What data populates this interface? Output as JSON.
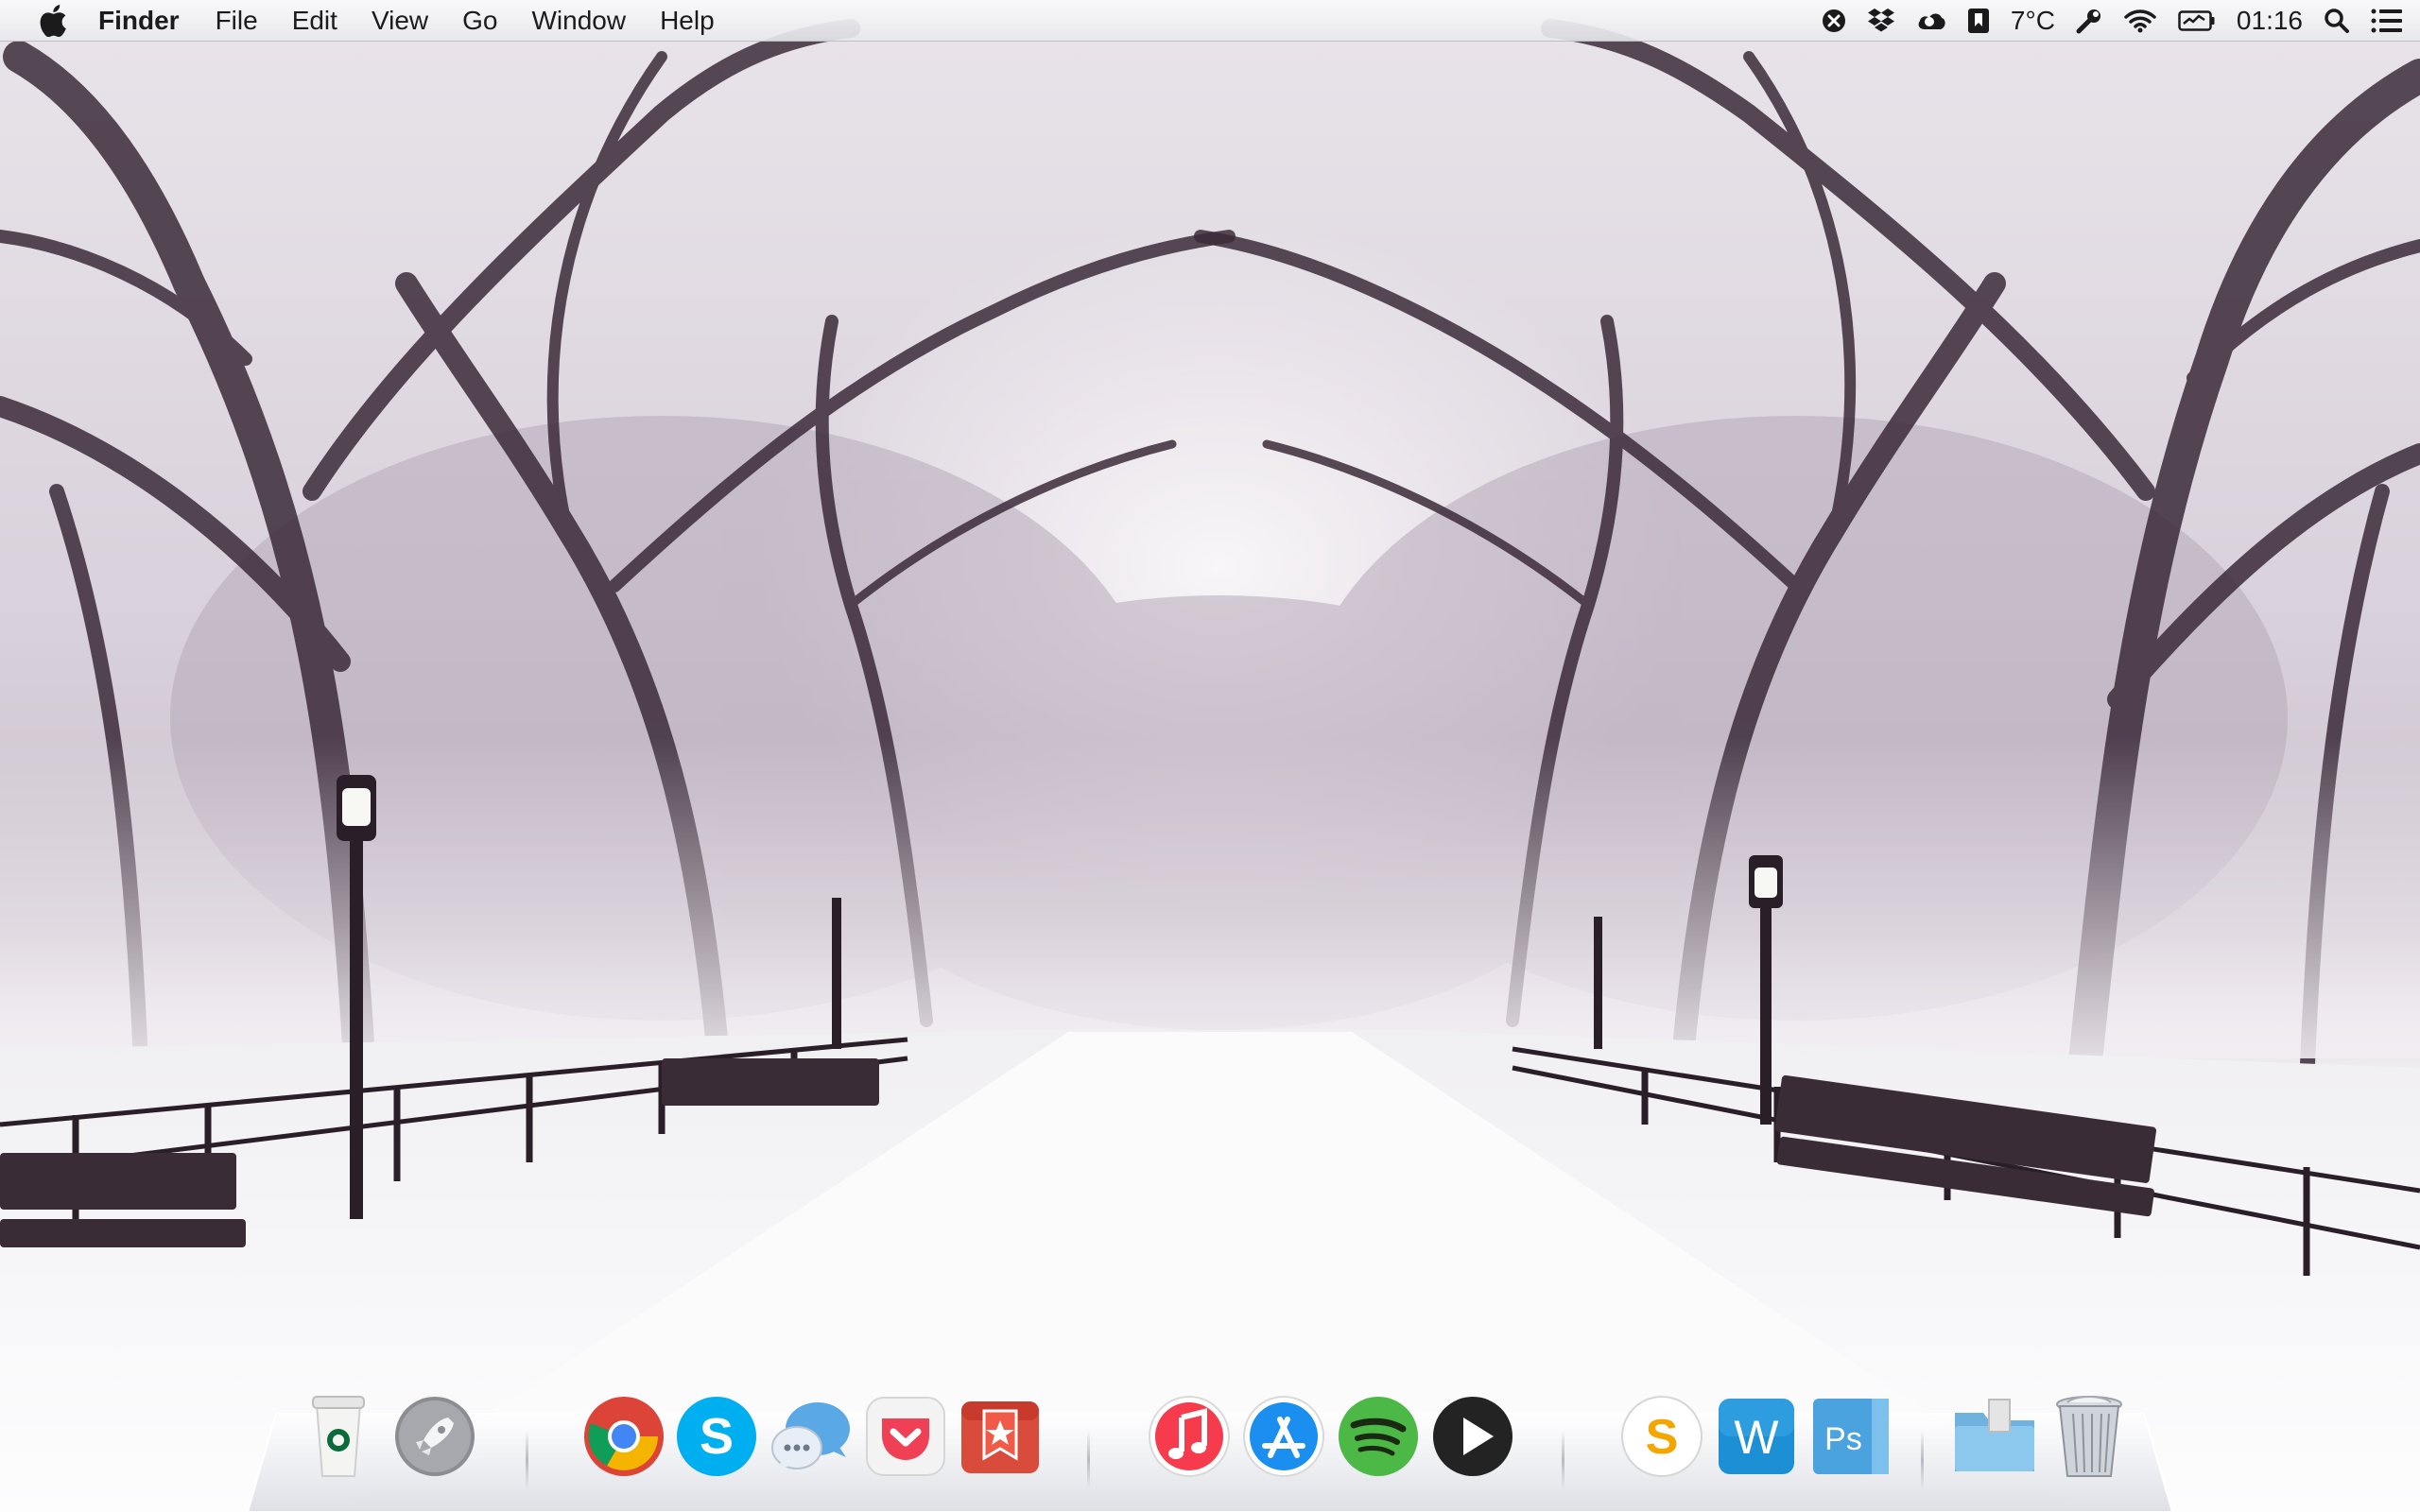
{
  "menubar": {
    "apple_icon": "apple-logo-icon",
    "app_name": "Finder",
    "menus": [
      "File",
      "Edit",
      "View",
      "Go",
      "Window",
      "Help"
    ],
    "status": {
      "weather": "7°C",
      "clock": "01:16"
    },
    "status_icons": [
      "close-x-icon",
      "dropbox-icon",
      "cloud-icon",
      "bookmark-icon",
      "weather-icon",
      "tools-icon",
      "wifi-icon",
      "battery-icon",
      "clock-icon",
      "spotlight-search-icon",
      "notification-center-icon"
    ]
  },
  "dock": {
    "groups": [
      [
        "starbucks-cup-icon",
        "launchpad-rocket-icon"
      ],
      [
        "chrome-icon",
        "skype-icon",
        "messages-icon",
        "pocket-icon",
        "wunderlist-icon"
      ],
      [
        "itunes-icon",
        "app-store-icon",
        "spotify-icon",
        "play-media-icon"
      ],
      [
        "sketch-s-icon",
        "word-icon",
        "photoshop-icon"
      ],
      [
        "downloads-folder-icon",
        "trash-icon"
      ]
    ],
    "colors": {
      "chrome_red": "#db4437",
      "chrome_green": "#0f9d58",
      "chrome_yellow": "#f4b400",
      "chrome_blue": "#4285f4",
      "skype_blue": "#00aff0",
      "spotify_green": "#4cb846",
      "pocket_red": "#ef4056",
      "wunderlist_red": "#d94b3b",
      "itunes_red": "#f63b4d",
      "appstore_blue": "#1b8ff0",
      "word_blue": "#1c8fd5",
      "photoshop_blue": "#4aa3de",
      "sketch_orange": "#f3a500"
    }
  }
}
